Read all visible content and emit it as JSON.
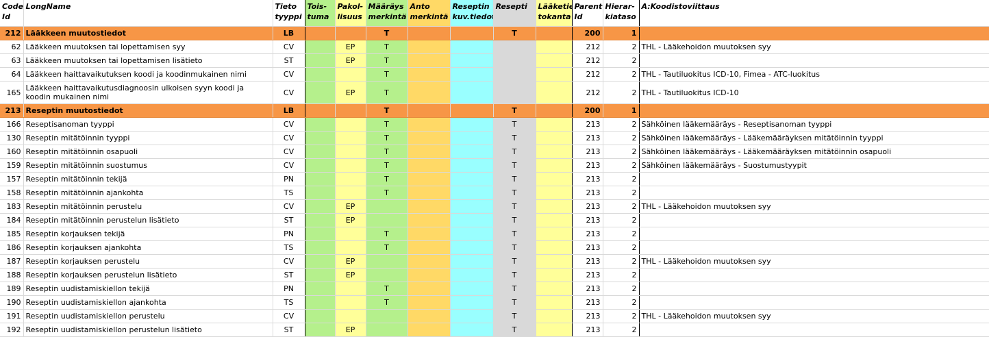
{
  "headers": {
    "code_id": "Code Id",
    "longname": "LongName",
    "tietotyyppi": "Tieto tyyppi",
    "toistuma": "Tois-tuma",
    "pakollisuus": "Pakol-lisuus",
    "maarays": "Määräys merkintä",
    "anto": "Anto merkintä",
    "reseptin_kuv": "Reseptin kuv.tiedot",
    "resepti": "Resepti",
    "laaketietokanta": "Lääketie tokanta",
    "parent_id": "Parent Id",
    "hierarkiataso": "Hierar-kiataso",
    "koodistoviittaus": "A:Koodistoviittaus"
  },
  "rows": [
    {
      "group": true,
      "code": "212",
      "name": "Lääkkeen muutostiedot",
      "type": "LB",
      "pakol": "",
      "maar": "T",
      "resepti": "T",
      "parent": "200",
      "level": "1",
      "ref": ""
    },
    {
      "code": "62",
      "name": "Lääkkeen muutoksen tai lopettamisen syy",
      "type": "CV",
      "pakol": "EP",
      "maar": "T",
      "resepti": "",
      "parent": "212",
      "level": "2",
      "ref": "THL - Lääkehoidon muutoksen syy"
    },
    {
      "code": "63",
      "name": "Lääkkeen muutoksen tai lopettamisen lisätieto",
      "type": "ST",
      "pakol": "EP",
      "maar": "T",
      "resepti": "",
      "parent": "212",
      "level": "2",
      "ref": ""
    },
    {
      "code": "64",
      "name": "Lääkkeen haittavaikutuksen koodi ja koodinmukainen nimi",
      "type": "CV",
      "pakol": "",
      "maar": "T",
      "resepti": "",
      "parent": "212",
      "level": "2",
      "ref": "THL - Tautiluokitus ICD-10, Fimea - ATC-luokitus"
    },
    {
      "code": "165",
      "name": "Lääkkeen haittavaikutusdiagnoosin ulkoisen syyn koodi ja koodin mukainen nimi",
      "type": "CV",
      "pakol": "EP",
      "maar": "T",
      "resepti": "",
      "parent": "212",
      "level": "2",
      "ref": "THL - Tautiluokitus ICD-10",
      "wrap": true
    },
    {
      "group": true,
      "code": "213",
      "name": "Reseptin muutostiedot",
      "type": "LB",
      "pakol": "",
      "maar": "T",
      "resepti": "T",
      "parent": "200",
      "level": "1",
      "ref": ""
    },
    {
      "code": "166",
      "name": "Reseptisanoman tyyppi",
      "type": "CV",
      "pakol": "",
      "maar": "T",
      "resepti": "T",
      "parent": "213",
      "level": "2",
      "ref": "Sähköinen lääkemääräys - Reseptisanoman tyyppi"
    },
    {
      "code": "130",
      "name": "Reseptin mitätöinnin tyyppi",
      "type": "CV",
      "pakol": "",
      "maar": "T",
      "resepti": "T",
      "parent": "213",
      "level": "2",
      "ref": "Sähköinen lääkemääräys - Lääkemääräyksen mitätöinnin tyyppi"
    },
    {
      "code": "160",
      "name": "Reseptin mitätöinnin osapuoli",
      "type": "CV",
      "pakol": "",
      "maar": "T",
      "resepti": "T",
      "parent": "213",
      "level": "2",
      "ref": "Sähköinen lääkemääräys - Lääkemääräyksen mitätöinnin osapuoli"
    },
    {
      "code": "159",
      "name": "Reseptin mitätöinnin suostumus",
      "type": "CV",
      "pakol": "",
      "maar": "T",
      "resepti": "T",
      "parent": "213",
      "level": "2",
      "ref": "Sähköinen lääkemääräys - Suostumustyypit"
    },
    {
      "code": "157",
      "name": "Reseptin mitätöinnin tekijä",
      "type": "PN",
      "pakol": "",
      "maar": "T",
      "resepti": "T",
      "parent": "213",
      "level": "2",
      "ref": ""
    },
    {
      "code": "158",
      "name": "Reseptin mitätöinnin ajankohta",
      "type": "TS",
      "pakol": "",
      "maar": "T",
      "resepti": "T",
      "parent": "213",
      "level": "2",
      "ref": ""
    },
    {
      "code": "183",
      "name": "Reseptin mitätöinnin perustelu",
      "type": "CV",
      "pakol": "EP",
      "maar": "",
      "resepti": "T",
      "parent": "213",
      "level": "2",
      "ref": "THL - Lääkehoidon muutoksen syy"
    },
    {
      "code": "184",
      "name": "Reseptin mitätöinnin perustelun lisätieto",
      "type": "ST",
      "pakol": "EP",
      "maar": "",
      "resepti": "T",
      "parent": "213",
      "level": "2",
      "ref": ""
    },
    {
      "code": "185",
      "name": "Reseptin korjauksen tekijä",
      "type": "PN",
      "pakol": "",
      "maar": "T",
      "resepti": "T",
      "parent": "213",
      "level": "2",
      "ref": ""
    },
    {
      "code": "186",
      "name": "Reseptin korjauksen ajankohta",
      "type": "TS",
      "pakol": "",
      "maar": "T",
      "resepti": "T",
      "parent": "213",
      "level": "2",
      "ref": ""
    },
    {
      "code": "187",
      "name": "Reseptin korjauksen perustelu",
      "type": "CV",
      "pakol": "EP",
      "maar": "",
      "resepti": "T",
      "parent": "213",
      "level": "2",
      "ref": "THL - Lääkehoidon muutoksen syy"
    },
    {
      "code": "188",
      "name": "Reseptin korjauksen perustelun lisätieto",
      "type": "ST",
      "pakol": "EP",
      "maar": "",
      "resepti": "T",
      "parent": "213",
      "level": "2",
      "ref": ""
    },
    {
      "code": "189",
      "name": "Reseptin uudistamiskiellon tekijä",
      "type": "PN",
      "pakol": "",
      "maar": "T",
      "resepti": "T",
      "parent": "213",
      "level": "2",
      "ref": ""
    },
    {
      "code": "190",
      "name": "Reseptin uudistamiskiellon ajankohta",
      "type": "TS",
      "pakol": "",
      "maar": "T",
      "resepti": "T",
      "parent": "213",
      "level": "2",
      "ref": ""
    },
    {
      "code": "191",
      "name": "Reseptin uudistamiskiellon perustelu",
      "type": "CV",
      "pakol": "",
      "maar": "",
      "resepti": "T",
      "parent": "213",
      "level": "2",
      "ref": "THL - Lääkehoidon muutoksen syy"
    },
    {
      "code": "192",
      "name": "Reseptin uudistamiskiellon perustelun  lisätieto",
      "type": "ST",
      "pakol": "EP",
      "maar": "",
      "resepti": "T",
      "parent": "213",
      "level": "2",
      "ref": ""
    }
  ]
}
